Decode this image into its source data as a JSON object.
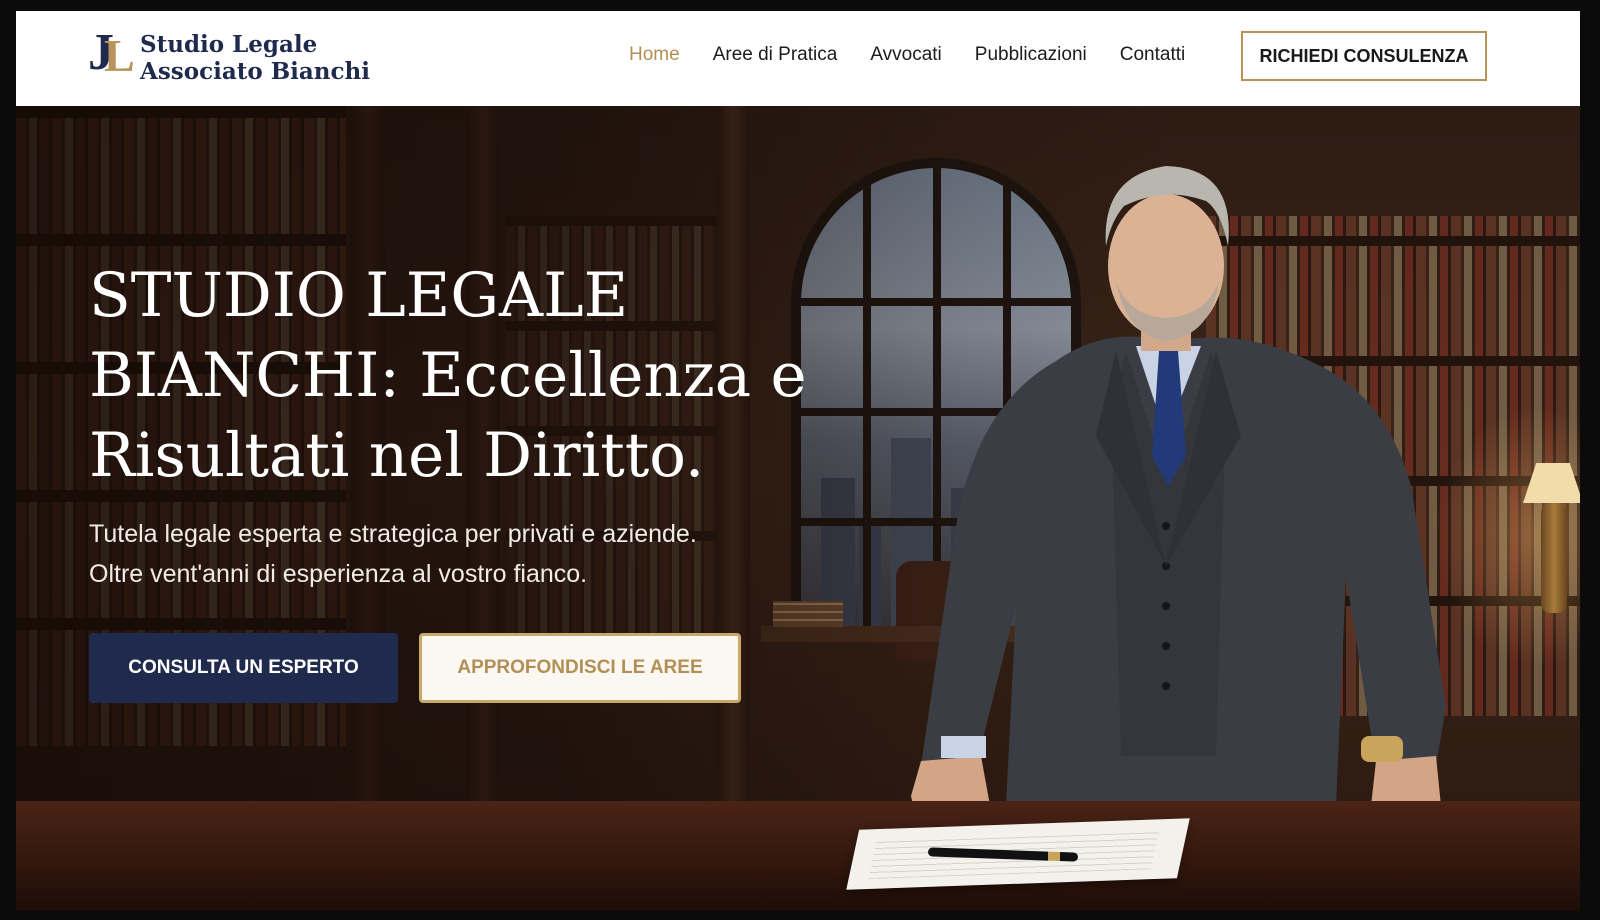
{
  "brand": {
    "mark_j": "J",
    "mark_l": "L",
    "name_line1": "Studio Legale",
    "name_line2": "Associato Bianchi",
    "colors": {
      "navy": "#1f2a4d",
      "gold": "#b8945a"
    }
  },
  "nav": {
    "links": [
      {
        "label": "Home",
        "active": true
      },
      {
        "label": "Aree di Pratica",
        "active": false
      },
      {
        "label": "Avvocati",
        "active": false
      },
      {
        "label": "Pubblicazioni",
        "active": false
      },
      {
        "label": "Contatti",
        "active": false
      }
    ],
    "cta_label": "RICHIEDI CONSULENZA"
  },
  "hero": {
    "title_lines": [
      "STUDIO LEGALE",
      "BIANCHI: Eccellenza e",
      "Risultati nel Diritto."
    ],
    "subtitle_lines": [
      "Tutela legale esperta e strategica per privati e aziende.",
      "Oltre vent'anni di esperienza al vostro fianco."
    ],
    "primary_button": "CONSULTA UN ESPERTO",
    "secondary_button": "APPROFONDISCI LE AREE"
  }
}
